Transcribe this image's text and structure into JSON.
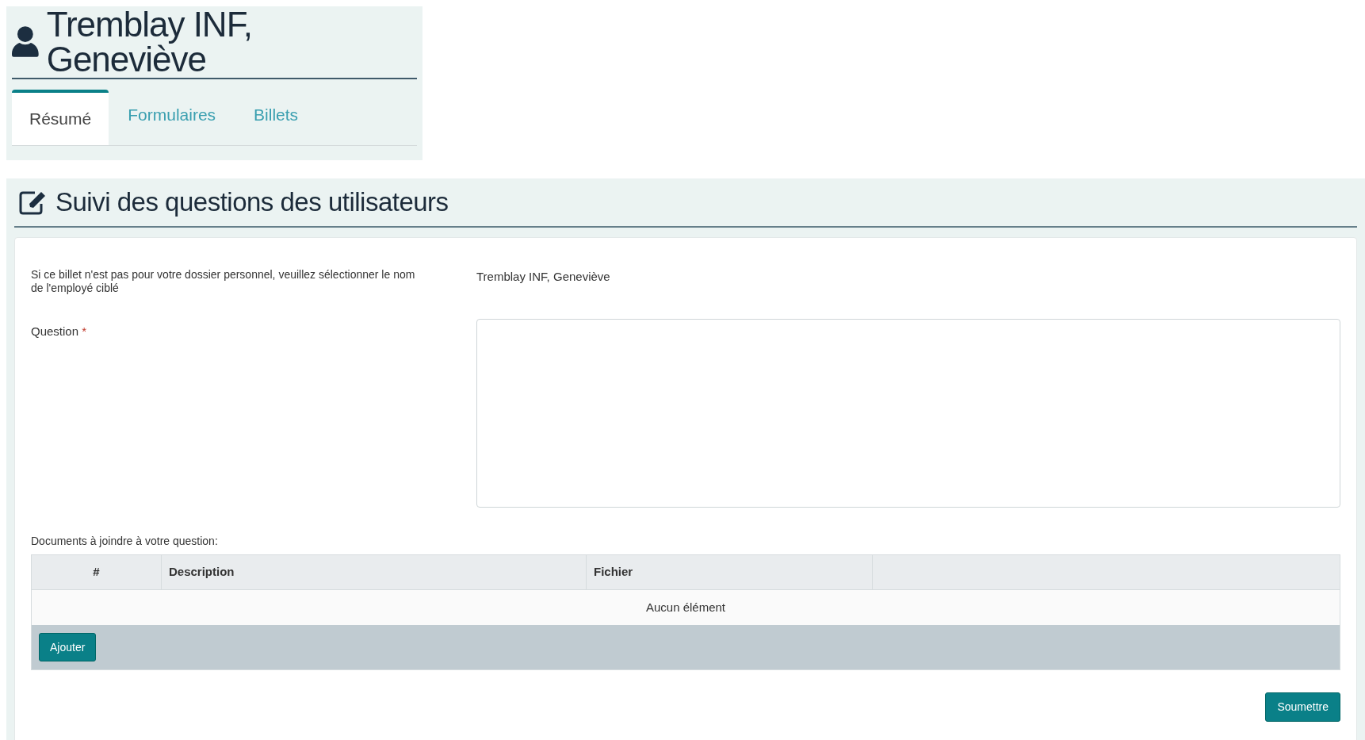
{
  "header": {
    "title": "Tremblay INF, Geneviève"
  },
  "tabs": [
    {
      "label": "Résumé",
      "selected": true
    },
    {
      "label": "Formulaires",
      "selected": false
    },
    {
      "label": "Billets",
      "selected": false
    }
  ],
  "section": {
    "title": "Suivi des questions des utilisateurs"
  },
  "form": {
    "employee_label": "Si ce billet n'est pas pour votre dossier personnel, veuillez sélectionner le nom de l'employé ciblé",
    "employee_value": "Tremblay INF, Geneviève",
    "question_label": "Question",
    "required_mark": "*"
  },
  "documents": {
    "label": "Documents à joindre à votre question:",
    "columns": [
      "#",
      "Description",
      "Fichier"
    ],
    "empty_text": "Aucun élément",
    "add_button": "Ajouter"
  },
  "submit_button": "Soumettre"
}
